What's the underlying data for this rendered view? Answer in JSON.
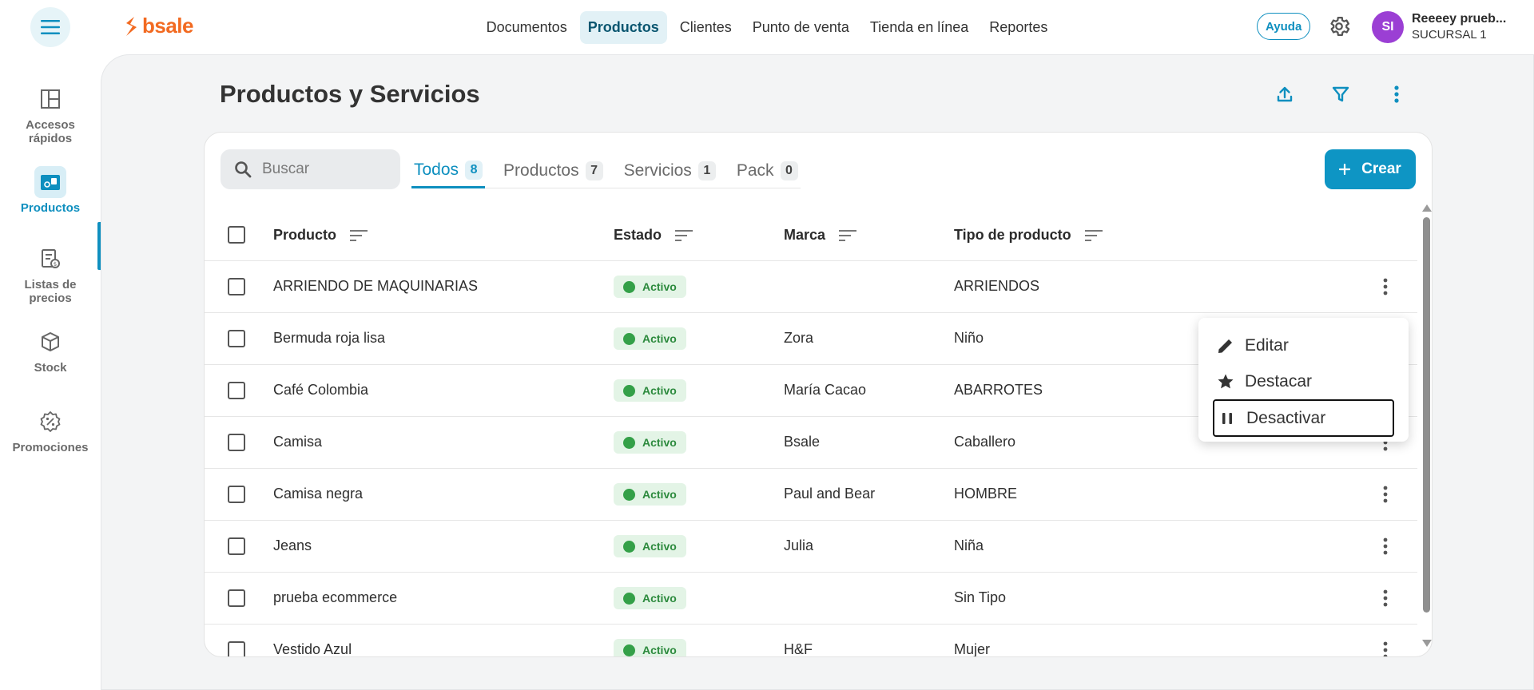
{
  "header": {
    "logo": "bsale",
    "nav": [
      "Documentos",
      "Productos",
      "Clientes",
      "Punto de venta",
      "Tienda en línea",
      "Reportes"
    ],
    "active_nav": "Productos",
    "help_label": "Ayuda",
    "avatar_initials": "SI",
    "user_name": "Reeeey prueb...",
    "user_branch": "SUCURSAL 1"
  },
  "sidebar": {
    "items": [
      {
        "label": "Accesos rápidos",
        "icon": "layout-icon"
      },
      {
        "label": "Productos",
        "icon": "products-icon"
      },
      {
        "label": "Listas de precios",
        "icon": "price-list-icon"
      },
      {
        "label": "Stock",
        "icon": "box-icon"
      },
      {
        "label": "Promociones",
        "icon": "promo-icon"
      }
    ],
    "active": "Productos"
  },
  "page": {
    "title": "Productos y Servicios"
  },
  "search": {
    "placeholder": "Buscar"
  },
  "tabs": [
    {
      "label": "Todos",
      "count": "8"
    },
    {
      "label": "Productos",
      "count": "7"
    },
    {
      "label": "Servicios",
      "count": "1"
    },
    {
      "label": "Pack",
      "count": "0"
    }
  ],
  "create_label": "Crear",
  "table": {
    "columns": [
      "Producto",
      "Estado",
      "Marca",
      "Tipo de producto"
    ],
    "rows": [
      {
        "producto": "ARRIENDO DE MAQUINARIAS",
        "estado": "Activo",
        "marca": "",
        "tipo": "ARRIENDOS"
      },
      {
        "producto": "Bermuda roja lisa",
        "estado": "Activo",
        "marca": "Zora",
        "tipo": "Niño"
      },
      {
        "producto": "Café Colombia",
        "estado": "Activo",
        "marca": "María Cacao",
        "tipo": "ABARROTES"
      },
      {
        "producto": "Camisa",
        "estado": "Activo",
        "marca": "Bsale",
        "tipo": "Caballero"
      },
      {
        "producto": "Camisa negra",
        "estado": "Activo",
        "marca": "Paul and Bear",
        "tipo": "HOMBRE"
      },
      {
        "producto": "Jeans",
        "estado": "Activo",
        "marca": "Julia",
        "tipo": "Niña"
      },
      {
        "producto": "prueba ecommerce",
        "estado": "Activo",
        "marca": "",
        "tipo": "Sin Tipo"
      },
      {
        "producto": "Vestido Azul",
        "estado": "Activo",
        "marca": "H&F",
        "tipo": "Mujer"
      }
    ]
  },
  "context_menu": {
    "items": [
      "Editar",
      "Destacar",
      "Desactivar"
    ]
  },
  "colors": {
    "accent": "#0e95c4",
    "brand": "#f26a21",
    "status_active": "#34a048"
  }
}
